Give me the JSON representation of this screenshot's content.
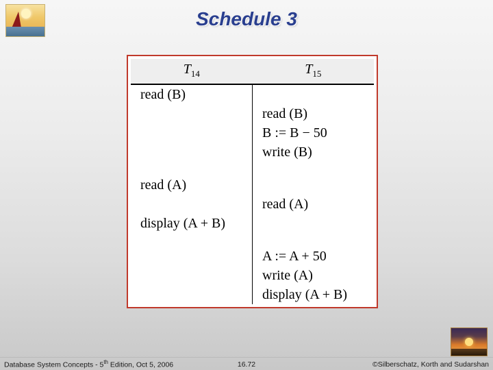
{
  "title": "Schedule 3",
  "columns": [
    {
      "t": "T",
      "sub": "14"
    },
    {
      "t": "T",
      "sub": "15"
    }
  ],
  "rows": [
    {
      "t14": "read (B)",
      "t15": ""
    },
    {
      "t14": "",
      "t15": "read (B)"
    },
    {
      "t14": "",
      "t15": "B := B − 50"
    },
    {
      "t14": "",
      "t15": "write (B)"
    },
    {
      "t14": "read (A)",
      "t15": ""
    },
    {
      "t14": "",
      "t15": "read (A)"
    },
    {
      "t14": "display (A + B)",
      "t15": ""
    },
    {
      "t14": "",
      "t15": "A := A + 50"
    },
    {
      "t14": "",
      "t15": "write (A)"
    },
    {
      "t14": "",
      "t15": "display (A + B)"
    }
  ],
  "spacer_after_idx": [
    3,
    6
  ],
  "footer": {
    "left_prefix": "Database System Concepts - 5",
    "left_sup": "th",
    "left_suffix": " Edition, Oct 5, 2006",
    "center": "16.72",
    "right": "©Silberschatz, Korth and Sudarshan"
  }
}
